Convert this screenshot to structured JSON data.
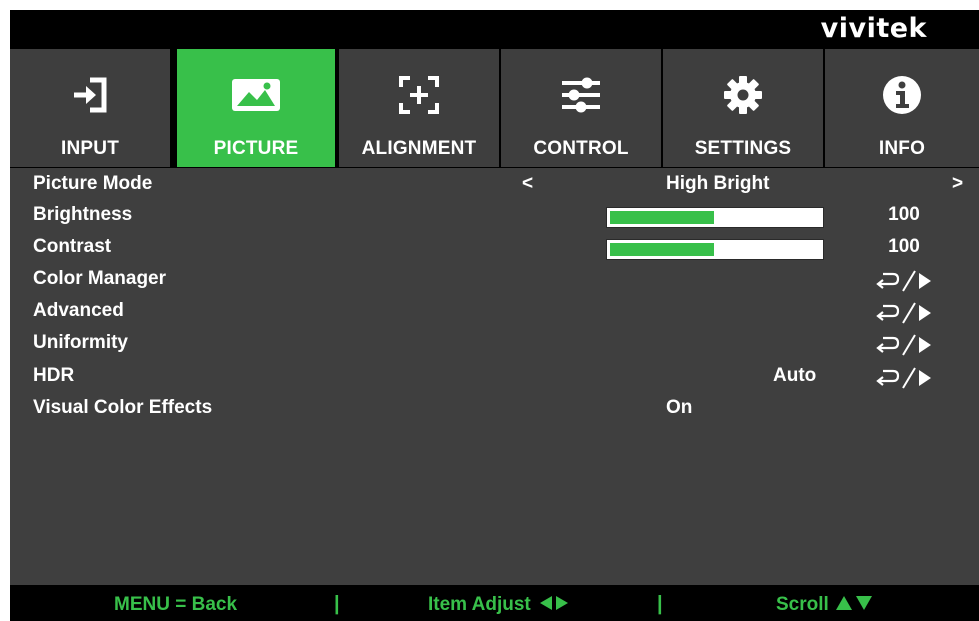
{
  "brand": "vivitek",
  "tabs": [
    {
      "label": "INPUT",
      "icon": "input-icon",
      "active": false
    },
    {
      "label": "PICTURE",
      "icon": "picture-icon",
      "active": true
    },
    {
      "label": "ALIGNMENT",
      "icon": "alignment-icon",
      "active": false
    },
    {
      "label": "CONTROL",
      "icon": "control-sliders-icon",
      "active": false
    },
    {
      "label": "SETTINGS",
      "icon": "gear-icon",
      "active": false
    },
    {
      "label": "INFO",
      "icon": "info-icon",
      "active": false
    }
  ],
  "menu": {
    "picture_mode": {
      "label": "Picture Mode",
      "left_arrow": "<",
      "value": "High Bright",
      "right_arrow": ">"
    },
    "brightness": {
      "label": "Brightness",
      "value": "100",
      "level": 0.5
    },
    "contrast": {
      "label": "Contrast",
      "value": "100",
      "level": 0.5
    },
    "color_manager": {
      "label": "Color Manager"
    },
    "advanced": {
      "label": "Advanced"
    },
    "uniformity": {
      "label": "Uniformity"
    },
    "hdr": {
      "label": "HDR",
      "value": "Auto"
    },
    "visual_color_effects": {
      "label": "Visual Color Effects",
      "value": "On"
    }
  },
  "footer": {
    "back": "MENU = Back",
    "separator": "|",
    "adjust": "Item Adjust",
    "scroll": "Scroll"
  },
  "colors": {
    "accent": "#38c04a",
    "tab_bg": "#3e3e3e",
    "panel_bg": "#3f3f3f",
    "frame": "#000000"
  }
}
